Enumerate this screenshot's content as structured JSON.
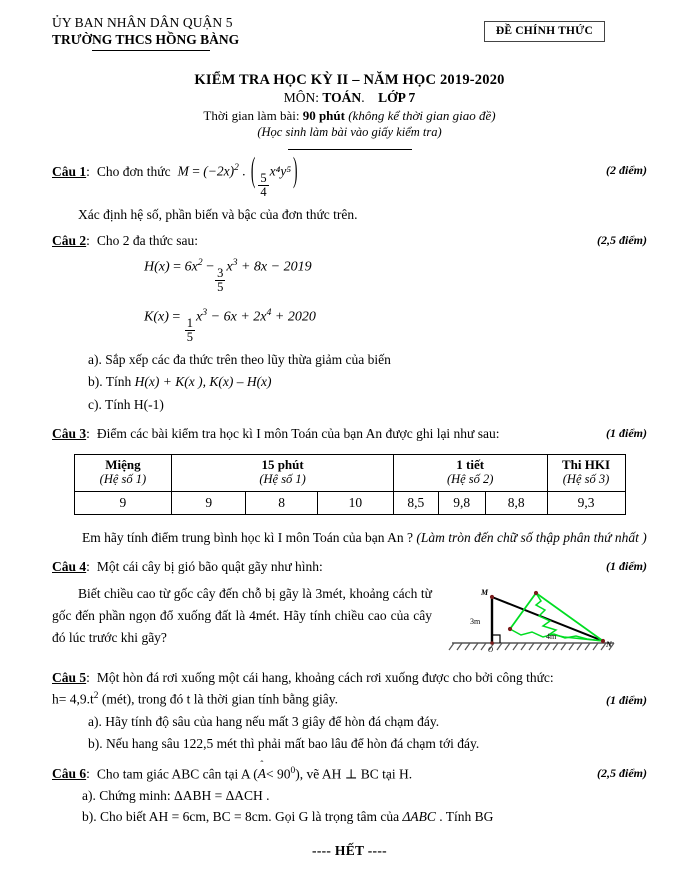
{
  "header": {
    "org_line1": "ỦY BAN NHÂN DÂN QUẬN 5",
    "org_line2": "TRƯỜNG THCS HỒNG BÀNG",
    "official_badge": "ĐỀ CHÍNH THỨC"
  },
  "title": {
    "exam_line": "KIỂM TRA HỌC KỲ II  –  NĂM HỌC 2019-2020",
    "subject_prefix": "MÔN:",
    "subject": "TOÁN",
    "subject_suffix": ".",
    "grade": "LỚP 7",
    "duration_prefix": "Thời gian làm bài:",
    "duration": "90 phút",
    "duration_note": "(không kể thời gian giao đề)",
    "instruction": "(Học sinh làm bài vào giấy kiểm tra)"
  },
  "questions": {
    "q1": {
      "label": "Câu 1",
      "colon": ":",
      "prompt": "Cho đơn thức",
      "points": "(2 điểm)",
      "formula": {
        "lhs": "M",
        "eq": "=",
        "base": "(−2x)",
        "exp": "2",
        "dot": ".",
        "frac_num": "5",
        "frac_den": "4",
        "tail": "x⁴y⁵"
      },
      "body": "Xác định hệ số, phần biến và bậc của đơn thức trên."
    },
    "q2": {
      "label": "Câu 2",
      "colon": ":",
      "prompt": "Cho 2 đa thức sau:",
      "points": "(2,5 điểm)",
      "H": {
        "name": "H",
        "arg": "(x)",
        "eq": "=",
        "t1": "6x",
        "t1e": "2",
        "minus": "−",
        "fn": "3",
        "fd": "5",
        "t2": "x",
        "t2e": "3",
        "rest": "+ 8x − 2019"
      },
      "K": {
        "name": "K",
        "arg": "(x)",
        "eq": "=",
        "fn": "1",
        "fd": "5",
        "t1": "x",
        "t1e": "3",
        "rest": "− 6x + 2x",
        "reste": "4",
        "tail": "+ 2020"
      },
      "a": "a).  Sắp xếp các đa thức trên theo lũy thừa giảm của biến",
      "b_prefix": "b).  Tính ",
      "b_math": "H(x) + K(x ), K(x) – H(x)",
      "c": "c).  Tính  H(-1)"
    },
    "q3": {
      "label": "Câu 3",
      "colon": ":",
      "prompt": "Điểm các bài kiểm tra học kì I môn Toán của bạn An được ghi lại như sau:",
      "points": "(1 điểm)",
      "table": {
        "headers": [
          {
            "name": "Miệng",
            "coef": "(Hệ số 1)",
            "span": 1
          },
          {
            "name": "15 phút",
            "coef": "(Hệ số 1)",
            "span": 3
          },
          {
            "name": "1 tiết",
            "coef": "(Hệ số 2)",
            "span": 3
          },
          {
            "name": "Thi HKI",
            "coef": "(Hệ số 3)",
            "span": 1
          }
        ],
        "values": [
          "9",
          "9",
          "8",
          "10",
          "8,5",
          "9,8",
          "8,8",
          "9,3"
        ]
      },
      "after_plain": "Em hãy tính điểm trung bình học kì I môn Toán của bạn An ? ",
      "after_italic": "(Làm tròn đến chữ số thập phân thứ nhất )"
    },
    "q4": {
      "label": "Câu 4",
      "colon": ":",
      "prompt": "Một cái cây bị gió bão quật gãy như hình:",
      "points": "(1 điểm)",
      "body": "Biết chiều cao từ gốc cây đến chỗ bị gãy là 3mét, khoảng cách từ gốc đến phần ngọn đổ xuống đất là 4mét. Hãy tính chiều cao của cây đó lúc trước khi gãy?",
      "figure": {
        "label_m": "M",
        "label_n": "N",
        "label_o": "O",
        "label_height": "3m",
        "label_base": "4m",
        "tree_color": "#00dd22",
        "line_color": "#000000"
      }
    },
    "q5": {
      "label": "Câu 5",
      "colon": ":",
      "prompt": "Một hòn đá rơi xuống một cái hang, khoảng cách rơi xuống được cho bởi công thức:",
      "formula_line": {
        "h": "h",
        "eq": "= 4,9.t",
        "exp": "2",
        "unit": "(mét),",
        "rest": "trong đó t là thời gian tính bằng giây."
      },
      "points": "(1 điểm)",
      "a": "a).  Hãy tính độ sâu của hang nếu mất 3 giây để hòn đá chạm đáy.",
      "b": "b). Nếu hang sâu 122,5 mét thì phải mất bao lâu để hòn đá chạm tới đáy."
    },
    "q6": {
      "label": "Câu 6",
      "colon": ":",
      "prompt_1": "Cho tam giác ABC cân tại A (",
      "prompt_angle": "A",
      "prompt_2": "< 90",
      "prompt_deg": "0",
      "prompt_3": "), vẽ  AH ⊥ BC  tại H.",
      "points": "(2,5 điểm)",
      "a": "a).  Chứng minh:  ΔABH = ΔACH .",
      "b_1": "b).  Cho biết AH = 6cm, BC = 8cm. Gọi G là trọng tâm của ",
      "b_math": "ΔABC",
      "b_2": " . Tính BG"
    }
  },
  "footer": {
    "end_mark": "---- HẾT ----"
  }
}
